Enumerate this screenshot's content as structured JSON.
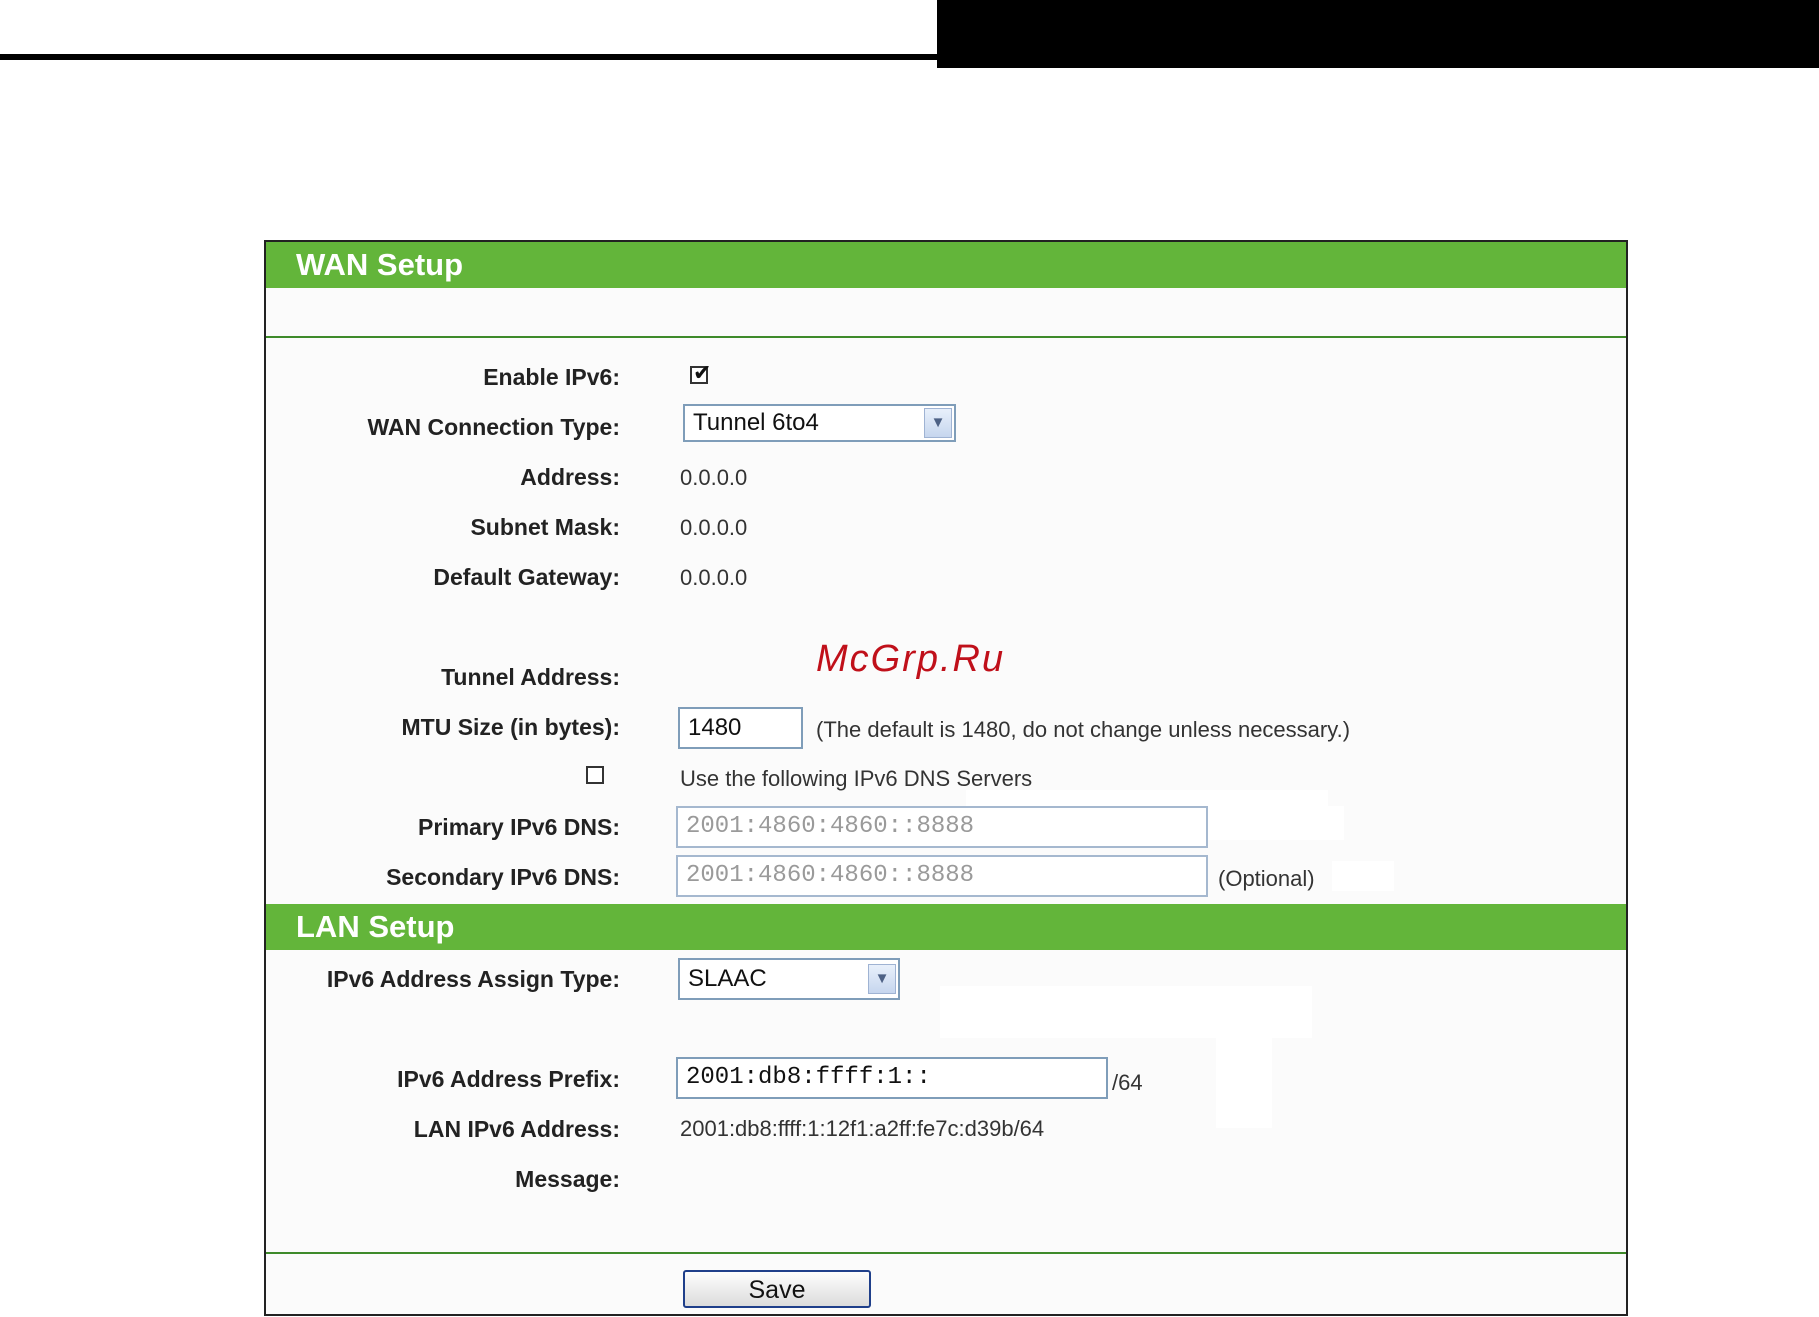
{
  "wan": {
    "header": "WAN Setup",
    "enable_ipv6_label": "Enable IPv6:",
    "enable_ipv6_checked": true,
    "connection_type_label": "WAN Connection Type:",
    "connection_type_value": "Tunnel 6to4",
    "address_label": "Address:",
    "address_value": "0.0.0.0",
    "subnet_label": "Subnet Mask:",
    "subnet_value": "0.0.0.0",
    "gateway_label": "Default Gateway:",
    "gateway_value": "0.0.0.0",
    "tunnel_label": "Tunnel Address:",
    "mtu_label": "MTU Size (in bytes):",
    "mtu_value": "1480",
    "mtu_hint": "(The default is 1480, do not change unless necessary.)",
    "dns_checkbox_label": "Use the following IPv6 DNS Servers",
    "dns_checkbox_checked": false,
    "primary_dns_label": "Primary IPv6 DNS:",
    "primary_dns_value": "2001:4860:4860::8888",
    "secondary_dns_label": "Secondary IPv6 DNS:",
    "secondary_dns_value": "2001:4860:4860::8888",
    "secondary_dns_hint": "(Optional)"
  },
  "lan": {
    "header": "LAN Setup",
    "assign_type_label": "IPv6 Address Assign Type:",
    "assign_type_value": "SLAAC",
    "prefix_label": "IPv6 Address Prefix:",
    "prefix_value": "2001:db8:ffff:1::",
    "prefix_suffix": "/64",
    "lan_address_label": "LAN IPv6 Address:",
    "lan_address_value": "2001:db8:ffff:1:12f1:a2ff:fe7c:d39b/64",
    "message_label": "Message:"
  },
  "actions": {
    "save_label": "Save"
  },
  "watermark": "McGrp.Ru",
  "colors": {
    "header_green": "#63b53a",
    "divider_green": "#3e8a2a"
  }
}
